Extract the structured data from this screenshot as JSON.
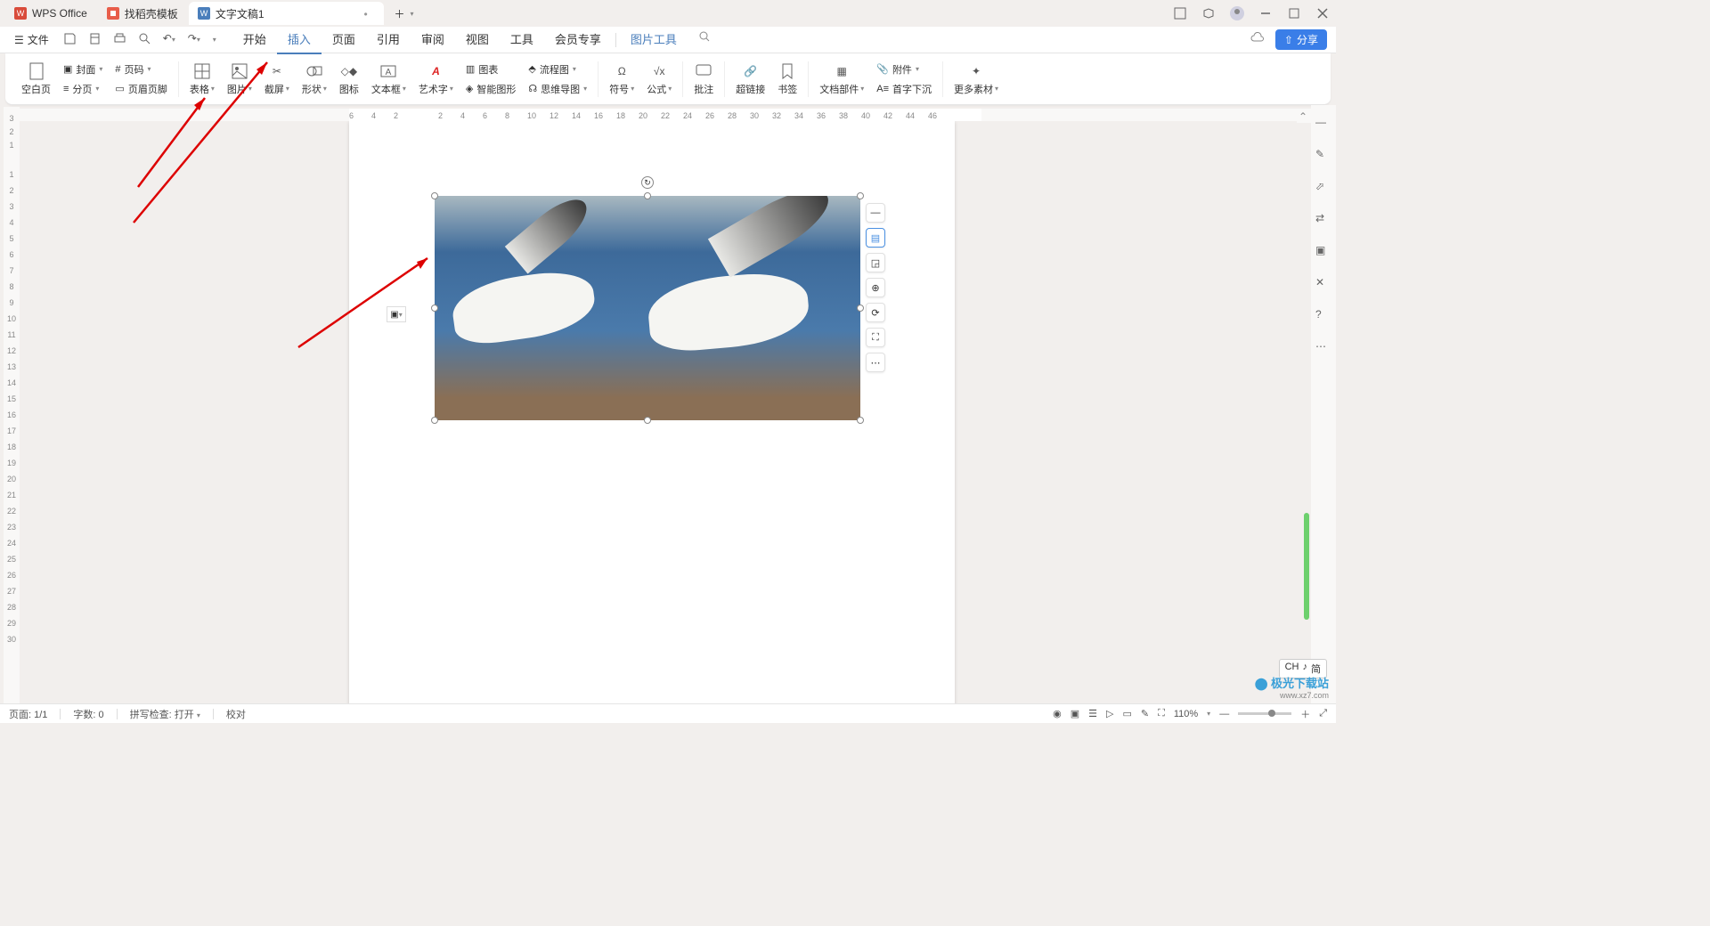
{
  "titlebar": {
    "app_tab": "WPS Office",
    "template_tab": "找稻壳模板",
    "doc_tab": "文字文稿1"
  },
  "menubar": {
    "file": "文件",
    "tabs": {
      "start": "开始",
      "insert": "插入",
      "page": "页面",
      "reference": "引用",
      "review": "审阅",
      "view": "视图",
      "tools": "工具",
      "member": "会员专享",
      "pic_tools": "图片工具"
    },
    "share": "分享"
  },
  "ribbon": {
    "blank_page": "空白页",
    "cover": "封面",
    "section": "分页",
    "page_num": "页码",
    "header_footer": "页眉页脚",
    "table": "表格",
    "picture": "图片",
    "screenshot": "截屏",
    "shape": "形状",
    "icon": "图标",
    "textbox": "文本框",
    "wordart": "艺术字",
    "chart": "图表",
    "smartart": "智能图形",
    "flowchart": "流程图",
    "mindmap": "思维导图",
    "symbol": "符号",
    "equation": "公式",
    "comment": "批注",
    "hyperlink": "超链接",
    "bookmark": "书签",
    "doc_parts": "文档部件",
    "attachment": "附件",
    "dropcap": "首字下沉",
    "more": "更多素材"
  },
  "ruler_h": [
    "6",
    "4",
    "2",
    "",
    "2",
    "4",
    "6",
    "8",
    "10",
    "12",
    "14",
    "16",
    "18",
    "20",
    "22",
    "24",
    "26",
    "28",
    "30",
    "32",
    "34",
    "36",
    "38",
    "40",
    "42",
    "44",
    "46"
  ],
  "ruler_v_neg": [
    "3",
    "2",
    "1"
  ],
  "ruler_v_pos": [
    "1",
    "2",
    "3",
    "4",
    "5",
    "6",
    "7",
    "8",
    "9",
    "10",
    "11",
    "12",
    "13",
    "14",
    "15",
    "16",
    "17",
    "18",
    "19",
    "20",
    "21",
    "22",
    "23",
    "24",
    "25",
    "26",
    "27",
    "28",
    "29",
    "30"
  ],
  "statusbar": {
    "page": "页面: 1/1",
    "words": "字数: 0",
    "spell": "拼写检查: 打开",
    "proof": "校对",
    "zoom": "110%"
  },
  "ime": {
    "ch": "CH",
    "pinyin": "♪",
    "simpl": "简"
  },
  "watermark": {
    "name": "极光下载站",
    "url": "www.xz7.com"
  }
}
